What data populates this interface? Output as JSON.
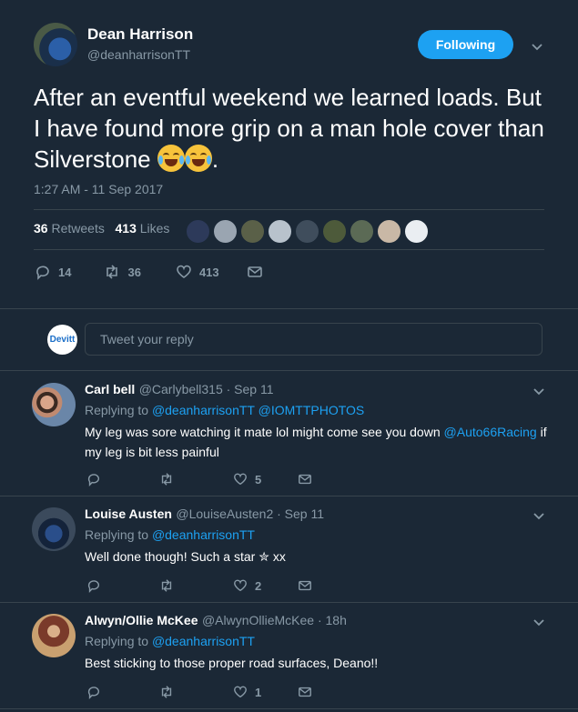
{
  "tweet": {
    "author_name": "Dean Harrison",
    "author_handle": "@deanharrisonTT",
    "follow_label": "Following",
    "text": "After an eventful weekend we learned loads. But I have found more grip on a man hole cover than Silverstone",
    "text_suffix": ".",
    "timestamp": "1:27 AM - 11 Sep 2017",
    "retweets_count": "36",
    "retweets_label": "Retweets",
    "likes_count": "413",
    "likes_label": "Likes",
    "actions": {
      "replies": "14",
      "retweets": "36",
      "likes": "413"
    }
  },
  "composer": {
    "avatar_text": "Devitt",
    "placeholder": "Tweet your reply"
  },
  "replies": [
    {
      "name": "Carl bell",
      "meta": "@Carlybell315 · Sep 11",
      "replying_prefix": "Replying to",
      "replying_to_1": "@deanharrisonTT",
      "replying_to_2": "@IOMTTPHOTOS",
      "text_1": "My leg was sore watching it mate lol might come see you down",
      "mention": "@Auto66Racing",
      "text_2": "if",
      "text_3": "my leg is bit less painful",
      "likes": "5"
    },
    {
      "name": "Louise Austen",
      "meta": "@LouiseAusten2 · Sep 11",
      "replying_prefix": "Replying to",
      "replying_to_1": "@deanharrisonTT",
      "text_1": "Well done though! Such a star ✮ xx",
      "likes": "2"
    },
    {
      "name": "Alwyn/Ollie McKee",
      "meta": "@AlwynOllieMcKee · 18h",
      "replying_prefix": "Replying to",
      "replying_to_1": "@deanharrisonTT",
      "text_1": "Best sticking to those proper road surfaces, Deano!!",
      "likes": "1"
    }
  ],
  "colors": {
    "background": "#1b2836",
    "accent": "#1da1f2",
    "muted": "#8899a6",
    "divider": "#38444d"
  }
}
